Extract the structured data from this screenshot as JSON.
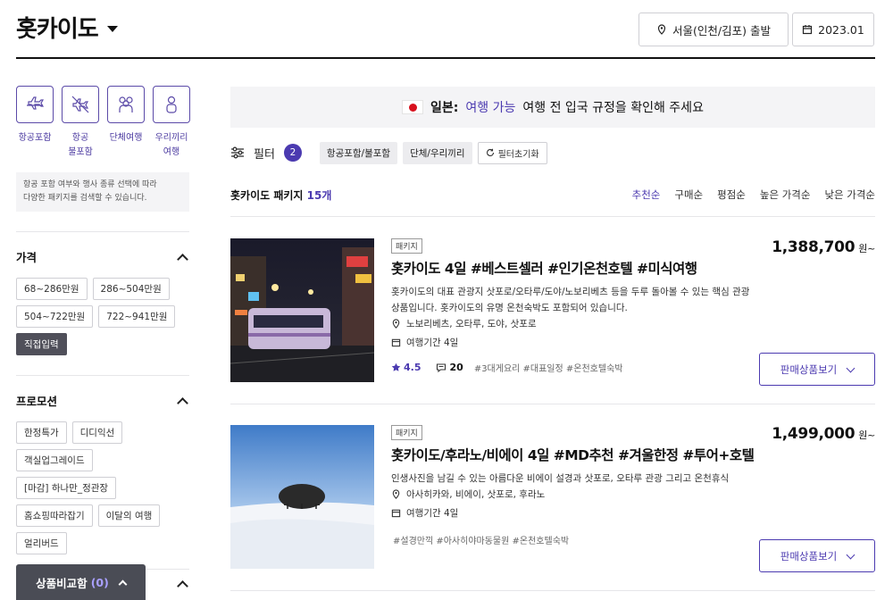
{
  "header": {
    "destination": "홋카이도",
    "departure": "서울(인천/김포) 출발",
    "date": "2023.01"
  },
  "sidebar": {
    "categories": [
      {
        "label": "항공포함",
        "icon": "plane-icon"
      },
      {
        "label": "항공\n불포함",
        "icon": "plane-off-icon"
      },
      {
        "label": "단체여행",
        "icon": "group-icon"
      },
      {
        "label": "우리끼리\n여행",
        "icon": "person-icon"
      }
    ],
    "note": "항공 포함 여부와 행사 종류 선택에 따라\n다양한 패키지를 검색할 수 있습니다.",
    "price": {
      "title": "가격",
      "options": [
        "68~286만원",
        "286~504만원",
        "504~722만원",
        "722~941만원",
        "직접입력"
      ]
    },
    "promotion": {
      "title": "프로모션",
      "options": [
        "한정특가",
        "디디익선",
        "객실업그레이드",
        "[마감] 하나만_정관장",
        "홈쇼핑따라잡기",
        "이달의 여행",
        "얼리버드"
      ]
    },
    "compare": {
      "label": "상품비교함",
      "count": "(0)"
    }
  },
  "banner": {
    "country": "일본:",
    "status": "여행 가능",
    "message": "여행 전 입국 규정을 확인해 주세요"
  },
  "filters": {
    "label": "필터",
    "count": "2",
    "tags": [
      "항공포함/불포함",
      "단체/우리끼리"
    ],
    "reset": "필터초기화"
  },
  "list": {
    "title_prefix": "홋카이도 패키지",
    "count": "15개",
    "sorts": [
      "추천순",
      "구매순",
      "평점순",
      "높은 가격순",
      "낮은 가격순"
    ],
    "active_sort": "추천순"
  },
  "products": [
    {
      "badge": "패키지",
      "title": "홋카이도 4일 #베스트셀러 #인기온천호텔 #미식여행",
      "desc": "홋카이도의 대표 관광지 삿포로/오타루/도야/노보리베츠 등을 두루 돌아볼 수 있는 핵심 관광 상품입니다. 홋카이도의 유명 온천숙박도 포함되어 있습니다.",
      "places": "노보리베츠, 오타루, 도야, 삿포로",
      "duration": "여행기간 4일",
      "rating": "4.5",
      "reviews": "20",
      "tags": "#3대게요리 #대표일정 #온천호텔숙박",
      "price": "1,388,700",
      "won": "원~",
      "buy": "판매상품보기"
    },
    {
      "badge": "패키지",
      "title": "홋카이도/후라노/비에이 4일 #MD추천 #겨울한정 #투어+호텔",
      "desc": "인생사진을 남길 수 있는 아름다운 비에이 설경과 삿포로, 오타루 관광 그리고 온천휴식",
      "places": "아사히카와, 비에이, 삿포로, 후라노",
      "duration": "여행기간 4일",
      "tags": "#설경만끽 #아사히야마동물원 #온천호텔숙박",
      "price": "1,499,000",
      "won": "원~",
      "buy": "판매상품보기"
    }
  ]
}
